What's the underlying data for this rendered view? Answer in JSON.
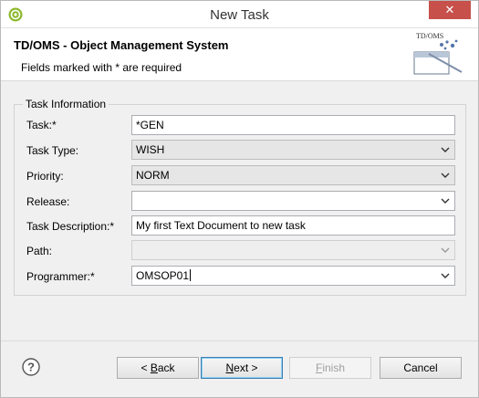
{
  "window": {
    "title": "New Task",
    "close_glyph": "✕"
  },
  "banner": {
    "title": "TD/OMS - Object Management System",
    "subtitle": "Fields marked with * are required",
    "logo_text": "TD/OMS"
  },
  "form": {
    "group_label": "Task Information",
    "task": {
      "label": "Task:*",
      "value": "*GEN"
    },
    "task_type": {
      "label": "Task Type:",
      "value": "WISH"
    },
    "priority": {
      "label": "Priority:",
      "value": "NORM"
    },
    "release": {
      "label": "Release:",
      "value": ""
    },
    "task_description": {
      "label": "Task Description:*",
      "value": "My first Text Document to new task"
    },
    "path": {
      "label": "Path:",
      "value": ""
    },
    "programmer": {
      "label": "Programmer:*",
      "value": "OMSOP01"
    }
  },
  "footer": {
    "back_prefix": "< ",
    "back_mnemonic": "B",
    "back_rest": "ack",
    "next_mnemonic": "N",
    "next_rest": "ext >",
    "finish_mnemonic": "F",
    "finish_rest": "inish",
    "cancel_label": "Cancel"
  },
  "colors": {
    "close_button": "#c7504a",
    "focus_border": "#3399ff",
    "app_icon": "#8bb92d"
  },
  "icons": [
    "app-icon",
    "close-icon",
    "chevron-down-icon",
    "help-icon",
    "tdoms-logo"
  ]
}
